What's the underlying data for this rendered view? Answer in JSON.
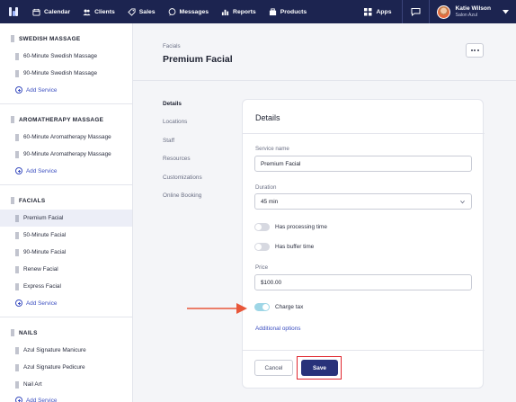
{
  "nav": {
    "items": [
      {
        "label": "Calendar",
        "icon": "calendar-icon"
      },
      {
        "label": "Clients",
        "icon": "clients-icon"
      },
      {
        "label": "Sales",
        "icon": "sales-tag-icon"
      },
      {
        "label": "Messages",
        "icon": "messages-icon"
      },
      {
        "label": "Reports",
        "icon": "reports-icon"
      },
      {
        "label": "Products",
        "icon": "products-icon"
      }
    ],
    "apps_label": "Apps",
    "user_name": "Katie Wilson",
    "user_org": "Salon Azul"
  },
  "sidebar": {
    "add_service_label": "Add Service",
    "categories": [
      {
        "name": "SWEDISH MASSAGE",
        "services": [
          "60-Minute Swedish Massage",
          "90-Minute Swedish Massage"
        ]
      },
      {
        "name": "AROMATHERAPY MASSAGE",
        "services": [
          "60-Minute Aromatherapy Massage",
          "90-Minute Aromatherapy Massage"
        ]
      },
      {
        "name": "FACIALS",
        "services": [
          "Premium Facial",
          "50-Minute Facial",
          "90-Minute Facial",
          "Renew Facial",
          "Express Facial"
        ]
      },
      {
        "name": "NAILS",
        "services": [
          "Azul Signature Manicure",
          "Azul Signature Pedicure",
          "Nail Art"
        ]
      }
    ],
    "active_service": "Premium Facial"
  },
  "page": {
    "breadcrumb": "Facials",
    "title": "Premium Facial"
  },
  "subnav": [
    "Details",
    "Locations",
    "Staff",
    "Resources",
    "Customizations",
    "Online Booking"
  ],
  "details": {
    "title": "Details",
    "service_name_label": "Service name",
    "service_name_value": "Premium Facial",
    "duration_label": "Duration",
    "duration_value": "45 min",
    "processing_time_label": "Has processing time",
    "processing_time_on": false,
    "buffer_time_label": "Has buffer time",
    "buffer_time_on": false,
    "price_label": "Price",
    "price_value": "$100.00",
    "charge_tax_label": "Charge tax",
    "charge_tax_on": true,
    "additional_options_label": "Additional options",
    "cancel_label": "Cancel",
    "save_label": "Save"
  },
  "colors": {
    "nav_bg": "#1c2450",
    "accent": "#3c4fc0",
    "save_bg": "#28327a",
    "highlight": "#e0272f",
    "arrow": "#e8573a",
    "toggle_on": "#9ed6e6"
  }
}
